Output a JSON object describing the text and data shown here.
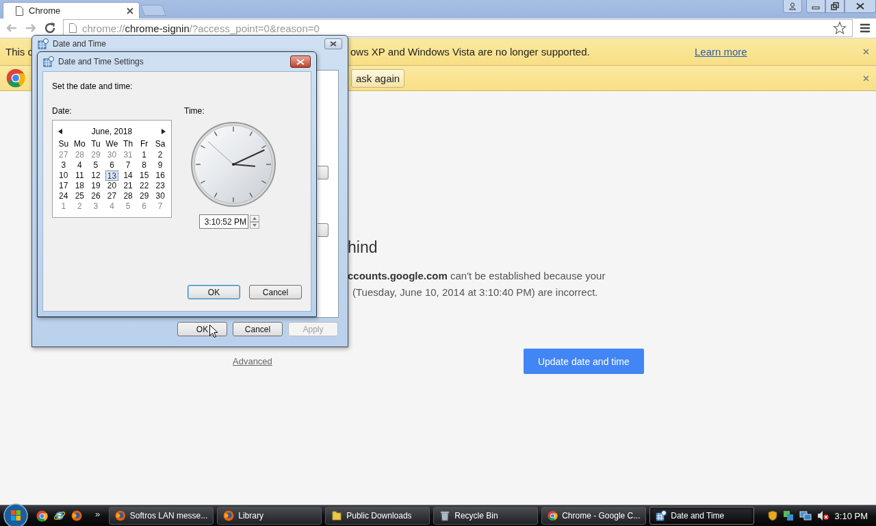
{
  "browser": {
    "tabs": [
      {
        "label": "Chrome",
        "selected": true
      }
    ],
    "url": {
      "scheme": "chrome://",
      "host": "chrome-signin",
      "path": "/?access_point=0&reason=0"
    },
    "infobars": [
      {
        "kind": "message",
        "text_left": "This c",
        "text_right": "ows XP and Windows Vista are no longer supported.",
        "link": "Learn more"
      },
      {
        "kind": "prompt",
        "button": "ask again"
      }
    ],
    "page": {
      "heading": "hind",
      "lines": [
        "**ccounts.google.com** can't be established because your",
        "(Tuesday, June 10, 2014 at 3:10:40 PM) are incorrect."
      ],
      "advanced_link": "Advanced",
      "primary_button": "Update date and time"
    }
  },
  "date_time_window": {
    "title": "Date and Time",
    "buttons": [
      {
        "label": "OK",
        "disabled": false
      },
      {
        "label": "Cancel",
        "disabled": false
      },
      {
        "label": "Apply",
        "disabled": true
      }
    ]
  },
  "settings_dialog": {
    "title": "Date and Time Settings",
    "instruction": "Set the date and time:",
    "date_label": "Date:",
    "time_label": "Time:",
    "calendar": {
      "month": "June, 2018",
      "weekdays": [
        "Su",
        "Mo",
        "Tu",
        "We",
        "Th",
        "Fr",
        "Sa"
      ],
      "weeks": [
        [
          {
            "day": "27",
            "other_month": true,
            "selected": false
          },
          {
            "day": "28",
            "other_month": true,
            "selected": false
          },
          {
            "day": "29",
            "other_month": true,
            "selected": false
          },
          {
            "day": "30",
            "other_month": true,
            "selected": false
          },
          {
            "day": "31",
            "other_month": true,
            "selected": false
          },
          {
            "day": "1",
            "other_month": false,
            "selected": false
          },
          {
            "day": "2",
            "other_month": false,
            "selected": false
          }
        ],
        [
          {
            "day": "3",
            "other_month": false,
            "selected": false
          },
          {
            "day": "4",
            "other_month": false,
            "selected": false
          },
          {
            "day": "5",
            "other_month": false,
            "selected": false
          },
          {
            "day": "6",
            "other_month": false,
            "selected": false
          },
          {
            "day": "7",
            "other_month": false,
            "selected": false
          },
          {
            "day": "8",
            "other_month": false,
            "selected": false
          },
          {
            "day": "9",
            "other_month": false,
            "selected": false
          }
        ],
        [
          {
            "day": "10",
            "other_month": false,
            "selected": false
          },
          {
            "day": "11",
            "other_month": false,
            "selected": false
          },
          {
            "day": "12",
            "other_month": false,
            "selected": false
          },
          {
            "day": "13",
            "other_month": false,
            "selected": true
          },
          {
            "day": "14",
            "other_month": false,
            "selected": false
          },
          {
            "day": "15",
            "other_month": false,
            "selected": false
          },
          {
            "day": "16",
            "other_month": false,
            "selected": false
          }
        ],
        [
          {
            "day": "17",
            "other_month": false,
            "selected": false
          },
          {
            "day": "18",
            "other_month": false,
            "selected": false
          },
          {
            "day": "19",
            "other_month": false,
            "selected": false
          },
          {
            "day": "20",
            "other_month": false,
            "selected": false
          },
          {
            "day": "21",
            "other_month": false,
            "selected": false
          },
          {
            "day": "22",
            "other_month": false,
            "selected": false
          },
          {
            "day": "23",
            "other_month": false,
            "selected": false
          }
        ],
        [
          {
            "day": "24",
            "other_month": false,
            "selected": false
          },
          {
            "day": "25",
            "other_month": false,
            "selected": false
          },
          {
            "day": "26",
            "other_month": false,
            "selected": false
          },
          {
            "day": "27",
            "other_month": false,
            "selected": false
          },
          {
            "day": "28",
            "other_month": false,
            "selected": false
          },
          {
            "day": "29",
            "other_month": false,
            "selected": false
          },
          {
            "day": "30",
            "other_month": false,
            "selected": false
          }
        ],
        [
          {
            "day": "1",
            "other_month": true,
            "selected": false
          },
          {
            "day": "2",
            "other_month": true,
            "selected": false
          },
          {
            "day": "3",
            "other_month": true,
            "selected": false
          },
          {
            "day": "4",
            "other_month": true,
            "selected": false
          },
          {
            "day": "5",
            "other_month": true,
            "selected": false
          },
          {
            "day": "6",
            "other_month": true,
            "selected": false
          },
          {
            "day": "7",
            "other_month": true,
            "selected": false
          }
        ]
      ]
    },
    "time_value": "3:10:52 PM",
    "buttons": [
      {
        "label": "OK",
        "default": true
      },
      {
        "label": "Cancel",
        "default": false
      }
    ]
  },
  "taskbar": {
    "overflow": "»",
    "items": [
      {
        "label": "Softros LAN messe...",
        "kind": "firefox",
        "selected": false
      },
      {
        "label": "Library",
        "kind": "firefox",
        "selected": false
      },
      {
        "label": "Public Downloads",
        "kind": "folder",
        "selected": false
      },
      {
        "label": "Recycle Bin",
        "kind": "recycle",
        "selected": false
      },
      {
        "label": "Chrome - Google C...",
        "kind": "chrome",
        "selected": false
      },
      {
        "label": "Date and Time",
        "kind": "datetime",
        "selected": true
      }
    ],
    "clock": "3:10 PM"
  }
}
